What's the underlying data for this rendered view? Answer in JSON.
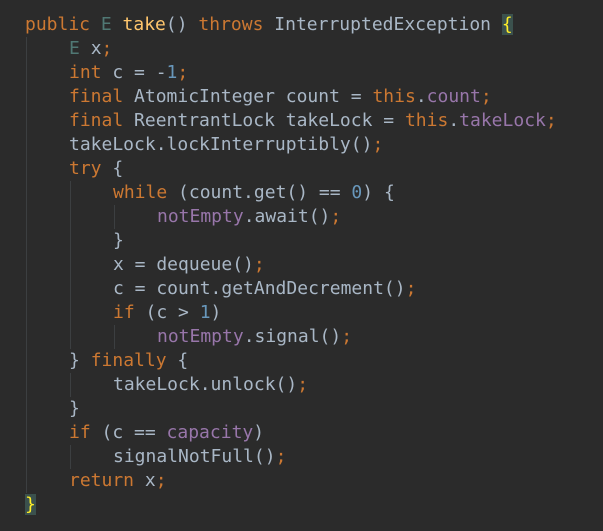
{
  "editor": {
    "colors": {
      "background": "#2b2b2b",
      "default": "#a9b7c6",
      "keyword": "#cc7832",
      "method_decl": "#ffc66d",
      "field": "#9876aa",
      "number": "#6897bb",
      "type_param": "#507874",
      "brace_match": "#ffef28",
      "brace_match_bg": "#3b514d",
      "indent_guide": "#3c3f41"
    },
    "lines": [
      {
        "indent": 0,
        "tokens": [
          {
            "t": "public ",
            "c": "keyword"
          },
          {
            "t": "E ",
            "c": "type_param"
          },
          {
            "t": "take",
            "c": "method_decl"
          },
          {
            "t": "() ",
            "c": "default"
          },
          {
            "t": "throws ",
            "c": "keyword"
          },
          {
            "t": "InterruptedException ",
            "c": "default"
          },
          {
            "t": "{",
            "c": "brace"
          }
        ]
      },
      {
        "indent": 1,
        "tokens": [
          {
            "t": "E ",
            "c": "type_param"
          },
          {
            "t": "x",
            "c": "default"
          },
          {
            "t": ";",
            "c": "keyword"
          }
        ]
      },
      {
        "indent": 1,
        "tokens": [
          {
            "t": "int ",
            "c": "keyword"
          },
          {
            "t": "c = -",
            "c": "default"
          },
          {
            "t": "1",
            "c": "number"
          },
          {
            "t": ";",
            "c": "keyword"
          }
        ]
      },
      {
        "indent": 1,
        "tokens": [
          {
            "t": "final ",
            "c": "keyword"
          },
          {
            "t": "AtomicInteger count = ",
            "c": "default"
          },
          {
            "t": "this",
            "c": "keyword"
          },
          {
            "t": ".",
            "c": "default"
          },
          {
            "t": "count",
            "c": "field"
          },
          {
            "t": ";",
            "c": "keyword"
          }
        ]
      },
      {
        "indent": 1,
        "tokens": [
          {
            "t": "final ",
            "c": "keyword"
          },
          {
            "t": "ReentrantLock takeLock = ",
            "c": "default"
          },
          {
            "t": "this",
            "c": "keyword"
          },
          {
            "t": ".",
            "c": "default"
          },
          {
            "t": "takeLock",
            "c": "field"
          },
          {
            "t": ";",
            "c": "keyword"
          }
        ]
      },
      {
        "indent": 1,
        "tokens": [
          {
            "t": "takeLock.lockInterruptibly()",
            "c": "default"
          },
          {
            "t": ";",
            "c": "keyword"
          }
        ]
      },
      {
        "indent": 1,
        "tokens": [
          {
            "t": "try ",
            "c": "keyword"
          },
          {
            "t": "{",
            "c": "default"
          }
        ]
      },
      {
        "indent": 2,
        "tokens": [
          {
            "t": "while ",
            "c": "keyword"
          },
          {
            "t": "(count.get() == ",
            "c": "default"
          },
          {
            "t": "0",
            "c": "number"
          },
          {
            "t": ") {",
            "c": "default"
          }
        ]
      },
      {
        "indent": 3,
        "tokens": [
          {
            "t": "notEmpty",
            "c": "field"
          },
          {
            "t": ".await()",
            "c": "default"
          },
          {
            "t": ";",
            "c": "keyword"
          }
        ]
      },
      {
        "indent": 2,
        "tokens": [
          {
            "t": "}",
            "c": "default"
          }
        ]
      },
      {
        "indent": 2,
        "tokens": [
          {
            "t": "x = dequeue()",
            "c": "default"
          },
          {
            "t": ";",
            "c": "keyword"
          }
        ]
      },
      {
        "indent": 2,
        "tokens": [
          {
            "t": "c = count.getAndDecrement()",
            "c": "default"
          },
          {
            "t": ";",
            "c": "keyword"
          }
        ]
      },
      {
        "indent": 2,
        "tokens": [
          {
            "t": "if ",
            "c": "keyword"
          },
          {
            "t": "(c > ",
            "c": "default"
          },
          {
            "t": "1",
            "c": "number"
          },
          {
            "t": ")",
            "c": "default"
          }
        ]
      },
      {
        "indent": 3,
        "tokens": [
          {
            "t": "notEmpty",
            "c": "field"
          },
          {
            "t": ".signal()",
            "c": "default"
          },
          {
            "t": ";",
            "c": "keyword"
          }
        ]
      },
      {
        "indent": 1,
        "tokens": [
          {
            "t": "} ",
            "c": "default"
          },
          {
            "t": "finally ",
            "c": "keyword"
          },
          {
            "t": "{",
            "c": "default"
          }
        ]
      },
      {
        "indent": 2,
        "tokens": [
          {
            "t": "takeLock.unlock()",
            "c": "default"
          },
          {
            "t": ";",
            "c": "keyword"
          }
        ]
      },
      {
        "indent": 1,
        "tokens": [
          {
            "t": "}",
            "c": "default"
          }
        ]
      },
      {
        "indent": 1,
        "tokens": [
          {
            "t": "if ",
            "c": "keyword"
          },
          {
            "t": "(c == ",
            "c": "default"
          },
          {
            "t": "capacity",
            "c": "field"
          },
          {
            "t": ")",
            "c": "default"
          }
        ]
      },
      {
        "indent": 2,
        "tokens": [
          {
            "t": "signalNotFull()",
            "c": "default"
          },
          {
            "t": ";",
            "c": "keyword"
          }
        ]
      },
      {
        "indent": 1,
        "tokens": [
          {
            "t": "return ",
            "c": "keyword"
          },
          {
            "t": "x",
            "c": "default"
          },
          {
            "t": ";",
            "c": "keyword"
          }
        ]
      },
      {
        "indent": 0,
        "tokens": [
          {
            "t": "}",
            "c": "brace"
          }
        ]
      }
    ]
  }
}
